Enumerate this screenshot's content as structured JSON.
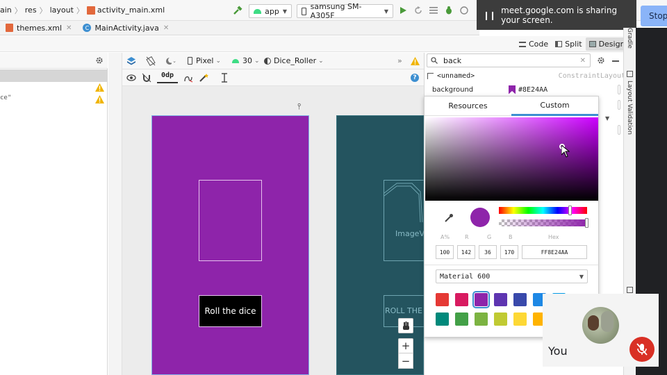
{
  "breadcrumbs": [
    "ain",
    "res",
    "layout",
    "activity_main.xml"
  ],
  "run_config": {
    "module": "app",
    "device": "samsung SM-A305F"
  },
  "file_tabs": [
    {
      "label": "themes.xml"
    },
    {
      "label": "MainActivity.java"
    }
  ],
  "share_banner": {
    "text": "meet.google.com is sharing your screen.",
    "stop_label": "Stop"
  },
  "view_modes": {
    "code": "Code",
    "split": "Split",
    "design": "Design"
  },
  "left_panel": {
    "snippet": "ce\""
  },
  "design_toolbar": {
    "device": "Pixel",
    "api": "30",
    "theme": "Dice_Roller",
    "margin": "0dp"
  },
  "preview": {
    "roll_button": "Roll the dice",
    "blueprint_image": "ImageVi",
    "blueprint_button": "ROLL THE"
  },
  "attributes": {
    "search_value": "back",
    "component": "<unnamed>",
    "layout_type": "ConstraintLayout",
    "attr_name": "background",
    "attr_value": "#8E24AA"
  },
  "color_picker": {
    "tabs": [
      "Resources",
      "Custom"
    ],
    "active_tab": "Custom",
    "channel_labels": [
      "A%",
      "R",
      "G",
      "B",
      "Hex"
    ],
    "channel_values": [
      "100",
      "142",
      "36",
      "170",
      "FF8E24AA"
    ],
    "palette": "Material 600",
    "selected_color": "#8E24AA",
    "swatches_row1": [
      "#E53935",
      "#D81B60",
      "#8E24AA",
      "#5E35B1",
      "#3949AB",
      "#1E88E5",
      "#039BE5"
    ],
    "swatches_row2": [
      "#00897B",
      "#43A047",
      "#7CB342",
      "#C0CA33",
      "#FDD835",
      "#FFB300"
    ]
  },
  "side_tools": [
    "Gradle",
    "Layout Validation"
  ],
  "self_view": {
    "label": "You"
  },
  "colors": {
    "accent": "#8E24AA",
    "blueprint": "#24545F",
    "share_bg": "#3C3C3C",
    "mic_off": "#D93025"
  }
}
